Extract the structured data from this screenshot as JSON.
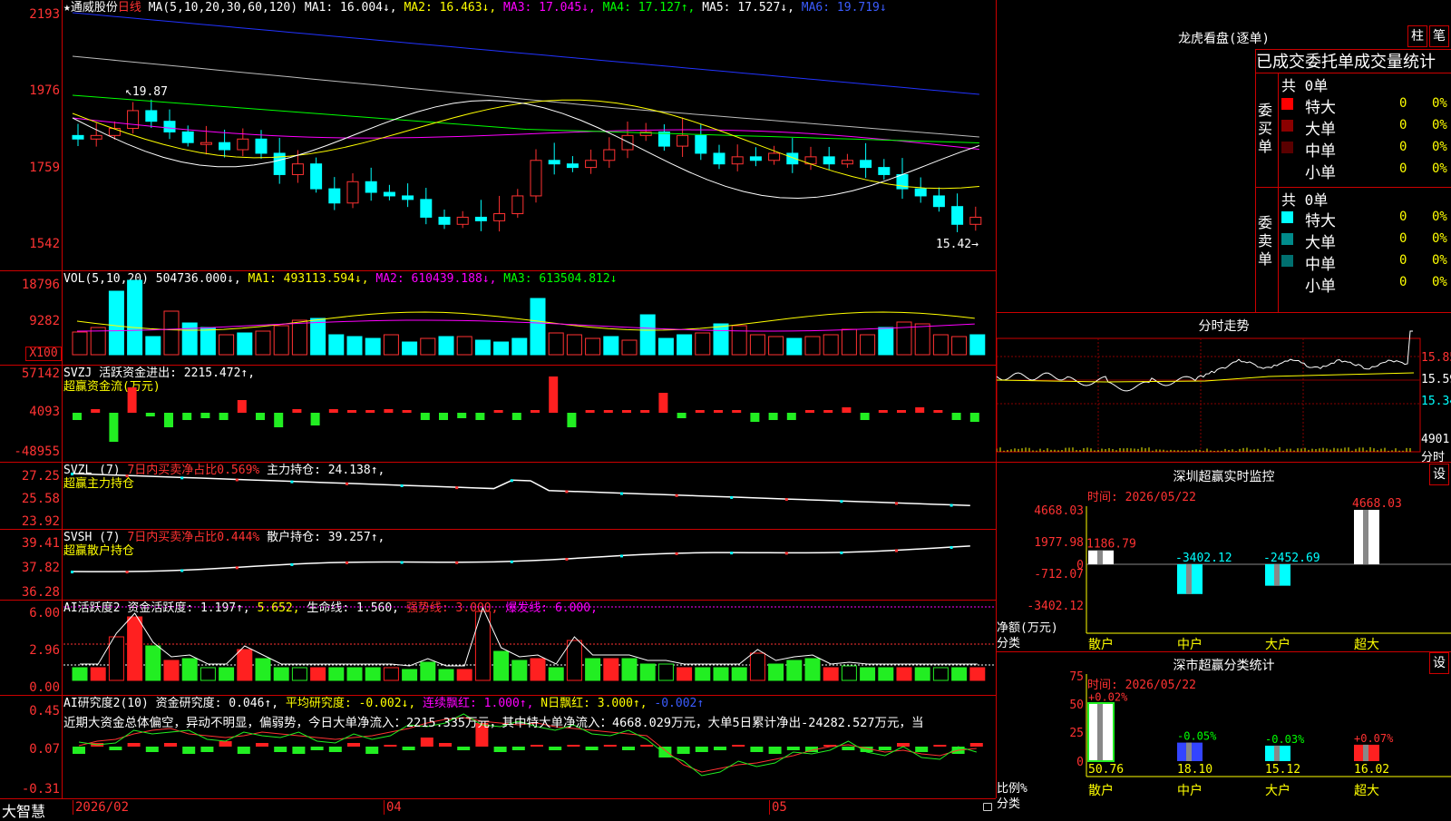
{
  "main": {
    "header": {
      "star": "★",
      "stock": "通威股份",
      "period": "日线",
      "ma_params": "MA(5,10,20,30,60,120)",
      "ma1": "MA1: 16.004↓,",
      "ma2": "MA2: 16.463↓,",
      "ma3": "MA3: 17.045↓,",
      "ma4": "MA4: 17.127↑,",
      "ma5": "MA5: 17.527↓,",
      "ma6": "MA6: 19.719↓"
    },
    "axis": [
      "2193",
      "1976",
      "1759",
      "1542"
    ],
    "high_label": "↖19.87",
    "low_label": "15.42→"
  },
  "vol": {
    "header": {
      "name": "VOL(5,10,20)",
      "v": "504736.000↓,",
      "ma1": "MA1: 493113.594↓,",
      "ma2": "MA2: 610439.188↓,",
      "ma3": "MA3: 613504.812↓"
    },
    "axis": [
      "18796",
      "9282"
    ],
    "unit": "X100"
  },
  "svzj": {
    "header": {
      "name": "SVZJ",
      "l1": "活跃资金进出: 2215.472↑,",
      "l2": "超赢资金流(万元)"
    },
    "axis": [
      "57142",
      "4093",
      "-48955"
    ]
  },
  "svzl": {
    "header": {
      "name": "SVZL (7)",
      "p1": "7日内买卖净占比0.569%",
      "p2": "主力持仓: 24.138↑,",
      "l2": "超赢主力持仓"
    },
    "axis": [
      "27.25",
      "25.58",
      "23.92"
    ]
  },
  "svsh": {
    "header": {
      "name": "SVSH (7)",
      "p1": "7日内买卖净占比0.444%",
      "p2": "散户持仓: 39.257↑,",
      "l2": "超赢散户持仓"
    },
    "axis": [
      "39.41",
      "37.82",
      "36.28"
    ]
  },
  "ai1": {
    "header": {
      "name": "AI活跃度2",
      "p1": "资金活跃度: 1.197↑,",
      "p2": "5.652,",
      "p3": "生命线: 1.560,",
      "p4": "强势线: 3.000,",
      "p5": "爆发线: 6.000,"
    },
    "axis": [
      "6.00",
      "2.96",
      "0.00"
    ]
  },
  "ai2": {
    "header": {
      "name": "AI研究度2(10)",
      "p1": "资金研究度: 0.046↑,",
      "p2": "平均研究度: -0.002↓,",
      "p3": "连续飘红: 1.000↑,",
      "p4": "N日飘红: 3.000↑,",
      "p5": "-0.002↑"
    },
    "text": "近期大资金总体偏空，异动不明显，偏弱势，今日大单净流入：2215.335万元，其中特大单净流入：4668.029万元，大单5日累计净出-24282.527万元，当",
    "axis": [
      "0.45",
      "0.07",
      "-0.31"
    ]
  },
  "dates": {
    "d1": "2026/02",
    "d2": "04",
    "d3": "05"
  },
  "brand": "大智慧",
  "longhu": {
    "title": "龙虎看盘(逐单)",
    "btn1": "柱",
    "btn2": "笔",
    "subtitle": "已成交委托单成交量统计",
    "buy_label": "委买单",
    "sell_label": "委卖单",
    "buy_total": "共 0单",
    "sell_total": "共 0单",
    "buy_rows": [
      {
        "label": "特大",
        "color": "#ff0000",
        "v": "0",
        "p": "0%"
      },
      {
        "label": "大单",
        "color": "#8b0000",
        "v": "0",
        "p": "0%"
      },
      {
        "label": "中单",
        "color": "#5a0000",
        "v": "0",
        "p": "0%"
      },
      {
        "label": "小单",
        "color": "#000000",
        "v": "0",
        "p": "0%"
      }
    ],
    "sell_rows": [
      {
        "label": "特大",
        "color": "#00ffff",
        "v": "0",
        "p": "0%"
      },
      {
        "label": "大单",
        "color": "#008b8b",
        "v": "0",
        "p": "0%"
      },
      {
        "label": "中单",
        "color": "#007070",
        "v": "0",
        "p": "0%"
      },
      {
        "label": "小单",
        "color": "#000000",
        "v": "0",
        "p": "0%"
      }
    ]
  },
  "intraday": {
    "title": "分时走势",
    "axis": [
      "15.85",
      "15.59",
      "15.34"
    ],
    "vol_label": "4901",
    "vol_unit": "分时"
  },
  "szmonitor": {
    "title": "深圳超赢实时监控",
    "btn": "设",
    "time": "时间: 2026/05/22",
    "axis": [
      "4668.03",
      "1977.98",
      "0",
      "-712.07",
      "-3402.12"
    ],
    "ylabel1": "净额(万元)",
    "ylabel2": "分类",
    "bars": [
      {
        "cat": "散户",
        "value": 1186.79,
        "label": "1186.79"
      },
      {
        "cat": "中户",
        "value": -3402.12,
        "label": "-3402.12"
      },
      {
        "cat": "大户",
        "value": -2452.69,
        "label": "-2452.69"
      },
      {
        "cat": "超大",
        "value": 4668.03,
        "label": "4668.03"
      }
    ]
  },
  "szclass": {
    "title": "深市超赢分类统计",
    "btn": "设",
    "time": "时间: 2026/05/22",
    "axis": [
      "75",
      "50",
      "25",
      "0"
    ],
    "ylabel1": "比例%",
    "ylabel2": "分类",
    "bars": [
      {
        "cat": "散户",
        "value": 50.76,
        "label": "50.76",
        "chg": "+0.02%",
        "chgcolor": "#ff3232"
      },
      {
        "cat": "中户",
        "value": 18.1,
        "label": "18.10",
        "chg": "-0.05%",
        "chgcolor": "#00ff00"
      },
      {
        "cat": "大户",
        "value": 15.12,
        "label": "15.12",
        "chg": "-0.03%",
        "chgcolor": "#00ff00"
      },
      {
        "cat": "超大",
        "value": 16.02,
        "label": "16.02",
        "chg": "+0.07%",
        "chgcolor": "#ff3232"
      }
    ]
  }
}
